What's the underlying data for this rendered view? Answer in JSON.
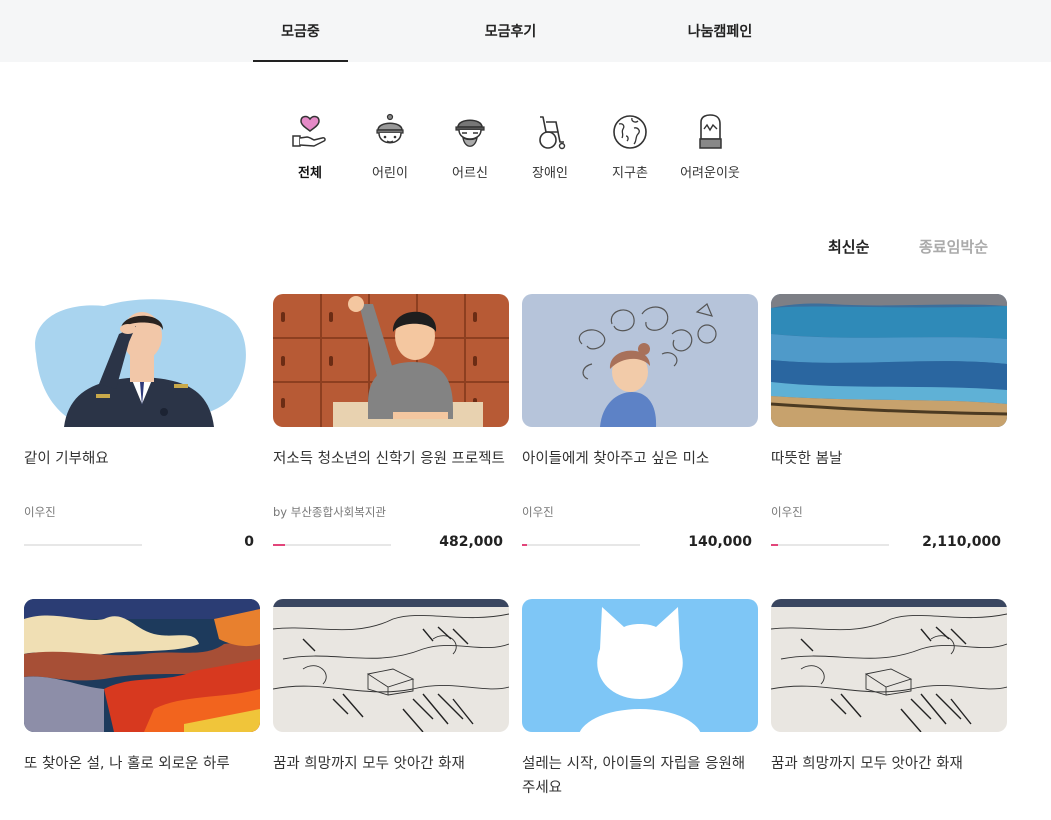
{
  "tabs": [
    {
      "label": "모금중",
      "active": true
    },
    {
      "label": "모금후기",
      "active": false
    },
    {
      "label": "나눔캠페인",
      "active": false
    }
  ],
  "categories": [
    {
      "label": "전체",
      "icon": "heart-hand-icon",
      "active": true
    },
    {
      "label": "어린이",
      "icon": "child-icon",
      "active": false
    },
    {
      "label": "어르신",
      "icon": "elder-icon",
      "active": false
    },
    {
      "label": "장애인",
      "icon": "wheelchair-icon",
      "active": false
    },
    {
      "label": "지구촌",
      "icon": "globe-icon",
      "active": false
    },
    {
      "label": "어려운이웃",
      "icon": "mitten-icon",
      "active": false
    }
  ],
  "sort": {
    "latest": "최신순",
    "ending": "종료임박순",
    "active": "latest"
  },
  "accent_color": "#e2457a",
  "cards": [
    {
      "title": "같이 기부해요",
      "org": "이우진",
      "amount": "0",
      "progress": 0
    },
    {
      "title": "저소득 청소년의 신학기 응원 프로젝트",
      "org": "by 부산종합사회복지관",
      "amount": "482,000",
      "progress": 0.1
    },
    {
      "title": "아이들에게 찾아주고 싶은 미소",
      "org": "이우진",
      "amount": "140,000",
      "progress": 0.04
    },
    {
      "title": "따뜻한 봄날",
      "org": "이우진",
      "amount": "2,110,000",
      "progress": 0.06
    },
    {
      "title": "또 찾아온 설, 나 홀로 외로운 하루"
    },
    {
      "title": "꿈과 희망까지 모두 앗아간 화재"
    },
    {
      "title": "설레는 시작, 아이들의 자립을 응원해주세요"
    },
    {
      "title": "꿈과 희망까지 모두 앗아간 화재"
    }
  ]
}
